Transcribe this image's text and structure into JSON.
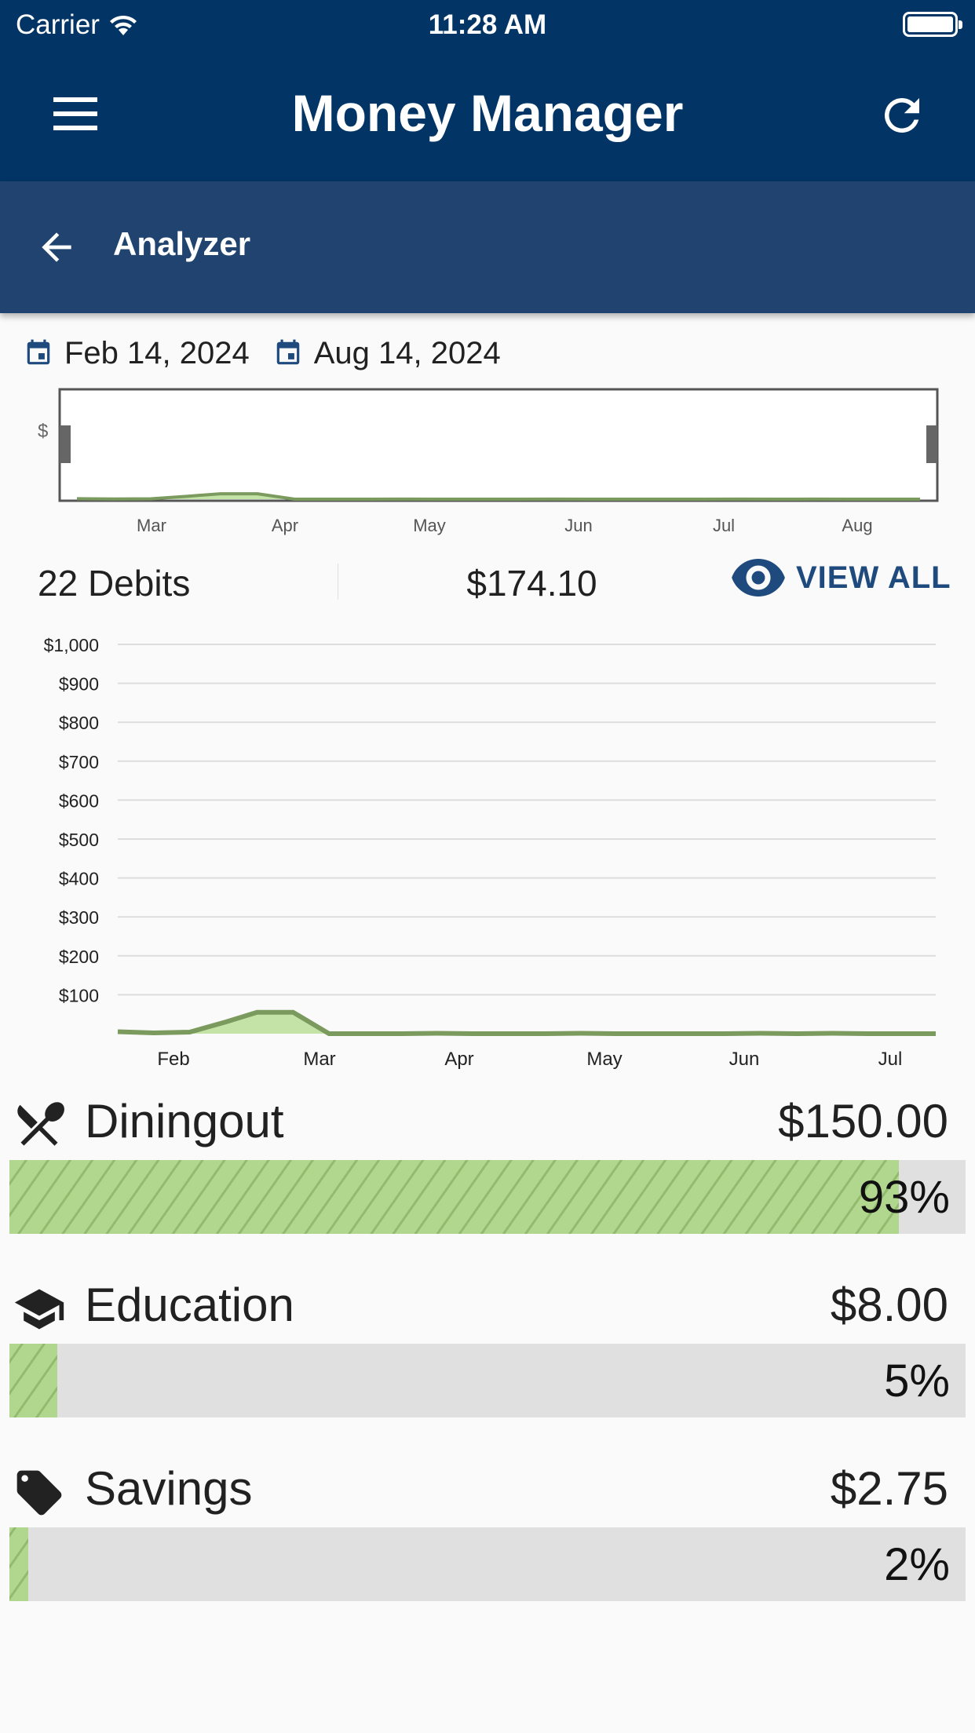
{
  "status_bar": {
    "carrier": "Carrier",
    "time": "11:28 AM"
  },
  "app_bar": {
    "title": "Money Manager",
    "menu_icon": "hamburger-menu-icon",
    "refresh_icon": "refresh-icon"
  },
  "sub_bar": {
    "title": "Analyzer",
    "back_icon": "arrow-back-icon"
  },
  "date_range": {
    "start": "Feb 14, 2024",
    "end": "Aug 14, 2024",
    "icon": "calendar-icon"
  },
  "summary": {
    "debits_label": "22 Debits",
    "total": "$174.10",
    "view_all_label": "VIEW ALL",
    "view_icon": "eye-icon"
  },
  "colors": {
    "primary": "#023565",
    "secondary": "#21436f",
    "accent": "#1f4a7e",
    "series_line": "#7a9a5e",
    "series_fill": "#c4e3a6",
    "bar_fill": "#b1d68e",
    "bar_track": "#e0e0e0"
  },
  "chart_data": [
    {
      "type": "area",
      "y_label_symbol": "$",
      "x_tick_labels": [
        "Mar",
        "Apr",
        "May",
        "Jun",
        "Jul",
        "Aug"
      ],
      "x": [
        0,
        8,
        16,
        24,
        31,
        39,
        47,
        55,
        63,
        71,
        79,
        87,
        95,
        103,
        111,
        119,
        127,
        135,
        143,
        151,
        159,
        167,
        175,
        182
      ],
      "values": [
        5,
        2,
        4,
        30,
        55,
        55,
        0,
        0,
        0,
        1,
        0,
        0,
        0,
        1,
        0,
        0,
        0,
        0,
        1,
        0,
        1,
        0,
        0,
        0
      ],
      "ylim": [
        0,
        1000
      ]
    },
    {
      "type": "area",
      "y_tick_labels": [
        "$1,000",
        "$900",
        "$800",
        "$700",
        "$600",
        "$500",
        "$400",
        "$300",
        "$200",
        "$100"
      ],
      "x_tick_labels": [
        "Feb",
        "Mar",
        "Apr",
        "May",
        "Jun",
        "Jul"
      ],
      "ylim": [
        0,
        1000
      ],
      "grid": true,
      "x": [
        0,
        8,
        16,
        24,
        31,
        39,
        47,
        55,
        63,
        71,
        79,
        87,
        95,
        103,
        111,
        119,
        127,
        135,
        143,
        151,
        159,
        167,
        175,
        182
      ],
      "values": [
        5,
        2,
        4,
        30,
        55,
        55,
        0,
        0,
        0,
        1,
        0,
        0,
        0,
        1,
        0,
        0,
        0,
        0,
        1,
        0,
        1,
        0,
        0,
        0
      ]
    }
  ],
  "categories": [
    {
      "name": "Diningout",
      "amount": "$150.00",
      "percent_label": "93%",
      "fraction": 0.93,
      "icon": "fork-spoon-icon"
    },
    {
      "name": "Education",
      "amount": "$8.00",
      "percent_label": "5%",
      "fraction": 0.05,
      "icon": "graduation-cap-icon"
    },
    {
      "name": "Savings",
      "amount": "$2.75",
      "percent_label": "2%",
      "fraction": 0.02,
      "icon": "tag-icon"
    }
  ]
}
